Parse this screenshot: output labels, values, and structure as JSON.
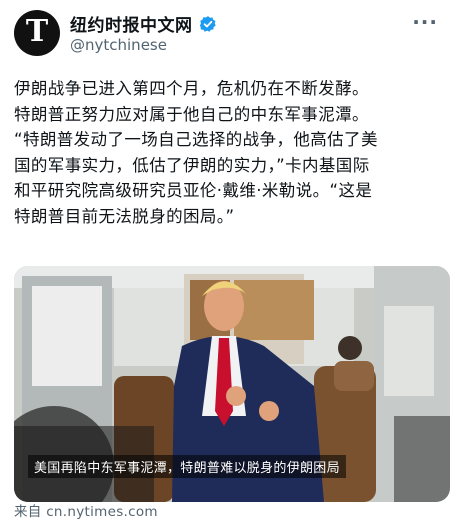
{
  "account": {
    "avatar_letter": "T",
    "display_name": "纽约时报中文网",
    "handle": "@nytchinese"
  },
  "post": {
    "lines": [
      "伊朗战争已进入第四个月，危机仍在不断发酵。",
      "特朗普正努力应对属于他自己的中东军事泥潭。",
      "“特朗普发动了一场自己选择的战争，他高估了美",
      "国的军事实力，低估了伊朗的实力，”卡内基国际",
      "和平研究院高级研究员亚伦·戴维·米勒说。“这是",
      "特朗普目前无法脱身的困局。”"
    ]
  },
  "media": {
    "caption": "美国再陷中东军事泥潭，特朗普难以脱身的伊朗困局"
  },
  "card": {
    "source": "来自 cn.nytimes.com"
  },
  "colors": {
    "verified": "#1d9bf0",
    "text": "#0f1419",
    "muted": "#536471"
  },
  "icons": {
    "verified": "verified-badge-icon",
    "more": "more-options-icon"
  }
}
